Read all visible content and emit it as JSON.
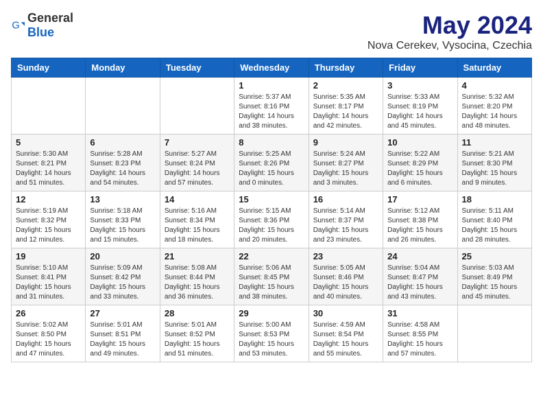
{
  "logo": {
    "general": "General",
    "blue": "Blue"
  },
  "title": "May 2024",
  "subtitle": "Nova Cerekev, Vysocina, Czechia",
  "weekdays": [
    "Sunday",
    "Monday",
    "Tuesday",
    "Wednesday",
    "Thursday",
    "Friday",
    "Saturday"
  ],
  "weeks": [
    [
      {
        "day": "",
        "info": ""
      },
      {
        "day": "",
        "info": ""
      },
      {
        "day": "",
        "info": ""
      },
      {
        "day": "1",
        "info": "Sunrise: 5:37 AM\nSunset: 8:16 PM\nDaylight: 14 hours\nand 38 minutes."
      },
      {
        "day": "2",
        "info": "Sunrise: 5:35 AM\nSunset: 8:17 PM\nDaylight: 14 hours\nand 42 minutes."
      },
      {
        "day": "3",
        "info": "Sunrise: 5:33 AM\nSunset: 8:19 PM\nDaylight: 14 hours\nand 45 minutes."
      },
      {
        "day": "4",
        "info": "Sunrise: 5:32 AM\nSunset: 8:20 PM\nDaylight: 14 hours\nand 48 minutes."
      }
    ],
    [
      {
        "day": "5",
        "info": "Sunrise: 5:30 AM\nSunset: 8:21 PM\nDaylight: 14 hours\nand 51 minutes."
      },
      {
        "day": "6",
        "info": "Sunrise: 5:28 AM\nSunset: 8:23 PM\nDaylight: 14 hours\nand 54 minutes."
      },
      {
        "day": "7",
        "info": "Sunrise: 5:27 AM\nSunset: 8:24 PM\nDaylight: 14 hours\nand 57 minutes."
      },
      {
        "day": "8",
        "info": "Sunrise: 5:25 AM\nSunset: 8:26 PM\nDaylight: 15 hours\nand 0 minutes."
      },
      {
        "day": "9",
        "info": "Sunrise: 5:24 AM\nSunset: 8:27 PM\nDaylight: 15 hours\nand 3 minutes."
      },
      {
        "day": "10",
        "info": "Sunrise: 5:22 AM\nSunset: 8:29 PM\nDaylight: 15 hours\nand 6 minutes."
      },
      {
        "day": "11",
        "info": "Sunrise: 5:21 AM\nSunset: 8:30 PM\nDaylight: 15 hours\nand 9 minutes."
      }
    ],
    [
      {
        "day": "12",
        "info": "Sunrise: 5:19 AM\nSunset: 8:32 PM\nDaylight: 15 hours\nand 12 minutes."
      },
      {
        "day": "13",
        "info": "Sunrise: 5:18 AM\nSunset: 8:33 PM\nDaylight: 15 hours\nand 15 minutes."
      },
      {
        "day": "14",
        "info": "Sunrise: 5:16 AM\nSunset: 8:34 PM\nDaylight: 15 hours\nand 18 minutes."
      },
      {
        "day": "15",
        "info": "Sunrise: 5:15 AM\nSunset: 8:36 PM\nDaylight: 15 hours\nand 20 minutes."
      },
      {
        "day": "16",
        "info": "Sunrise: 5:14 AM\nSunset: 8:37 PM\nDaylight: 15 hours\nand 23 minutes."
      },
      {
        "day": "17",
        "info": "Sunrise: 5:12 AM\nSunset: 8:38 PM\nDaylight: 15 hours\nand 26 minutes."
      },
      {
        "day": "18",
        "info": "Sunrise: 5:11 AM\nSunset: 8:40 PM\nDaylight: 15 hours\nand 28 minutes."
      }
    ],
    [
      {
        "day": "19",
        "info": "Sunrise: 5:10 AM\nSunset: 8:41 PM\nDaylight: 15 hours\nand 31 minutes."
      },
      {
        "day": "20",
        "info": "Sunrise: 5:09 AM\nSunset: 8:42 PM\nDaylight: 15 hours\nand 33 minutes."
      },
      {
        "day": "21",
        "info": "Sunrise: 5:08 AM\nSunset: 8:44 PM\nDaylight: 15 hours\nand 36 minutes."
      },
      {
        "day": "22",
        "info": "Sunrise: 5:06 AM\nSunset: 8:45 PM\nDaylight: 15 hours\nand 38 minutes."
      },
      {
        "day": "23",
        "info": "Sunrise: 5:05 AM\nSunset: 8:46 PM\nDaylight: 15 hours\nand 40 minutes."
      },
      {
        "day": "24",
        "info": "Sunrise: 5:04 AM\nSunset: 8:47 PM\nDaylight: 15 hours\nand 43 minutes."
      },
      {
        "day": "25",
        "info": "Sunrise: 5:03 AM\nSunset: 8:49 PM\nDaylight: 15 hours\nand 45 minutes."
      }
    ],
    [
      {
        "day": "26",
        "info": "Sunrise: 5:02 AM\nSunset: 8:50 PM\nDaylight: 15 hours\nand 47 minutes."
      },
      {
        "day": "27",
        "info": "Sunrise: 5:01 AM\nSunset: 8:51 PM\nDaylight: 15 hours\nand 49 minutes."
      },
      {
        "day": "28",
        "info": "Sunrise: 5:01 AM\nSunset: 8:52 PM\nDaylight: 15 hours\nand 51 minutes."
      },
      {
        "day": "29",
        "info": "Sunrise: 5:00 AM\nSunset: 8:53 PM\nDaylight: 15 hours\nand 53 minutes."
      },
      {
        "day": "30",
        "info": "Sunrise: 4:59 AM\nSunset: 8:54 PM\nDaylight: 15 hours\nand 55 minutes."
      },
      {
        "day": "31",
        "info": "Sunrise: 4:58 AM\nSunset: 8:55 PM\nDaylight: 15 hours\nand 57 minutes."
      },
      {
        "day": "",
        "info": ""
      }
    ]
  ]
}
